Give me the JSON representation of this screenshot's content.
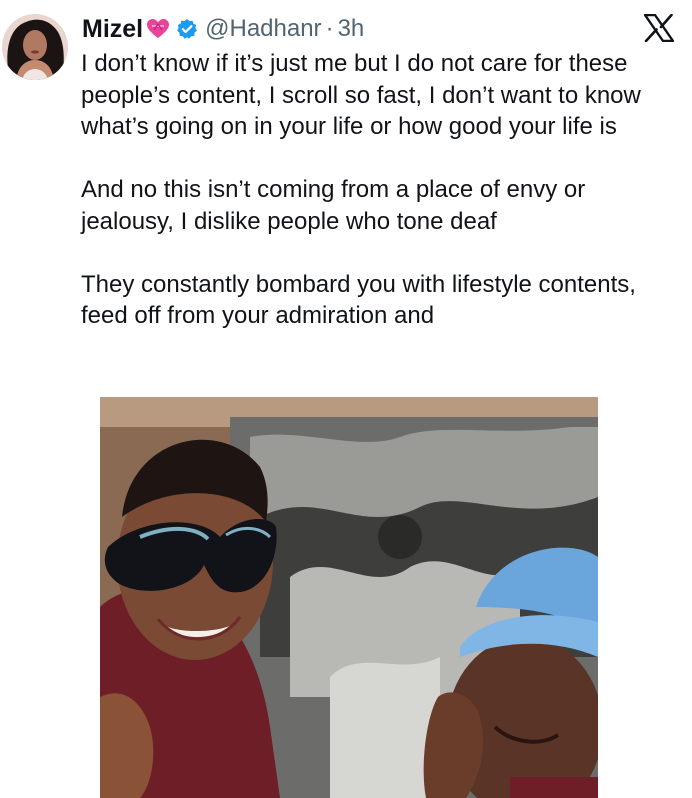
{
  "tweet": {
    "author": {
      "display_name": "Mizel",
      "name_emoji": "heart-with-ribbon-icon",
      "verified_badge": "verified-icon",
      "handle": "@Hadhanr",
      "separator": "·",
      "time": "3h"
    },
    "platform_logo": "x-logo-icon",
    "text": {
      "paragraph_1": "I don’t know if it’s just me but I do not care for these people’s content, I scroll so fast, I don’t want to know what’s going on in your life or how good your life is",
      "paragraph_2": "And no this isn’t coming from a place of envy or jealousy, I dislike people who tone deaf",
      "paragraph_3": "They constantly bombard you with lifestyle contents, feed off from your admiration and"
    },
    "media": {
      "kind": "photo"
    }
  },
  "colors": {
    "text": "#0f1419",
    "secondary_text": "#536471",
    "verified_blue": "#1d9bf0",
    "emoji_pink": "#e8449a"
  }
}
